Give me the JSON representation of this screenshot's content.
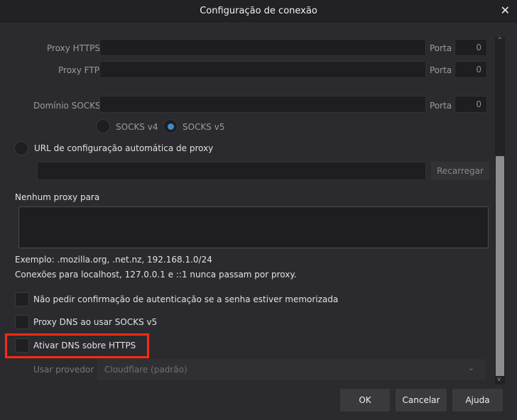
{
  "window": {
    "title": "Configuração de conexão",
    "close": "✕"
  },
  "proxy": {
    "https_label": "Proxy HTTPS",
    "https_value": "",
    "https_port_label": "Porta",
    "https_port": "0",
    "ftp_label": "Proxy FTP",
    "ftp_value": "",
    "ftp_port_label": "Porta",
    "ftp_port": "0",
    "socks_label": "Domínio SOCKS",
    "socks_value": "",
    "socks_port_label": "Porta",
    "socks_port": "0",
    "socks_v4": "SOCKS v4",
    "socks_v5": "SOCKS v5",
    "socks_selected": "v5"
  },
  "auto": {
    "label": "URL de configuração automática de proxy",
    "value": "",
    "reload": "Recarregar"
  },
  "no_proxy": {
    "label": "Nenhum proxy para",
    "value": "",
    "example": "Exemplo: .mozilla.org, .net.nz, 192.168.1.0/24",
    "note": "Conexões para localhost, 127.0.0.1 e ::1 nunca passam por proxy."
  },
  "options": [
    {
      "label": "Não pedir confirmação de autenticação se a senha estiver memorizada",
      "checked": false
    },
    {
      "label": "Proxy DNS ao usar SOCKS v5",
      "checked": false
    },
    {
      "label": "Ativar DNS sobre HTTPS",
      "checked": false
    }
  ],
  "provider": {
    "label": "Usar provedor",
    "value": "Cloudflare (padrão)"
  },
  "buttons": {
    "ok": "OK",
    "cancel": "Cancelar",
    "help": "Ajuda"
  },
  "colors": {
    "highlight": "#ff2a12",
    "accent": "#3f8ec3"
  }
}
